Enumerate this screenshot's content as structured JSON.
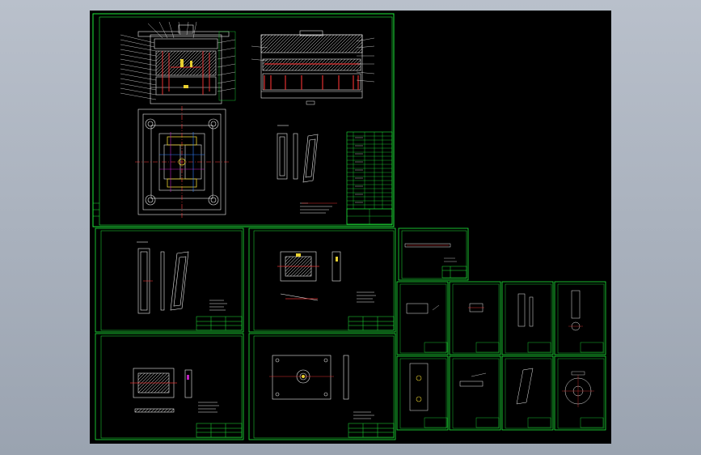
{
  "app": {
    "viewport_background": "#000000",
    "surround_color": "#a9b1bd"
  },
  "colors": {
    "frame": "#1eea3a",
    "part": "#e8e8e8",
    "highlight": "#e23030",
    "center_line": "#ff3b3b",
    "accent_yellow": "#e8d030",
    "accent_magenta": "#c020c0",
    "accent_blue": "#3080ff"
  },
  "sheets": [
    {
      "id": "assembly-drawing",
      "kind": "assembly"
    },
    {
      "id": "part-sheet-1",
      "kind": "part"
    },
    {
      "id": "part-sheet-2",
      "kind": "part"
    },
    {
      "id": "part-sheet-3",
      "kind": "part"
    },
    {
      "id": "part-sheet-4",
      "kind": "part"
    },
    {
      "id": "part-sheet-5",
      "kind": "part"
    },
    {
      "id": "small-sheet-1",
      "kind": "part"
    },
    {
      "id": "small-sheet-2",
      "kind": "part"
    },
    {
      "id": "small-sheet-3",
      "kind": "part"
    },
    {
      "id": "small-sheet-4",
      "kind": "part"
    },
    {
      "id": "small-sheet-5",
      "kind": "part"
    },
    {
      "id": "small-sheet-6",
      "kind": "part"
    },
    {
      "id": "small-sheet-7",
      "kind": "part"
    },
    {
      "id": "small-sheet-8",
      "kind": "part"
    }
  ]
}
